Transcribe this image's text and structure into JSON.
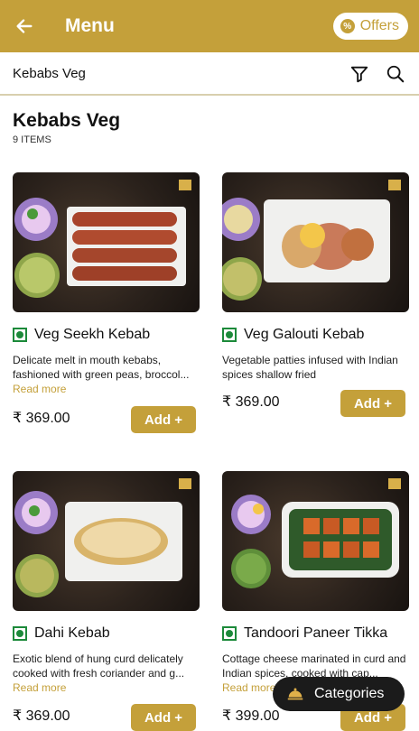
{
  "header": {
    "title": "Menu",
    "offers_label": "Offers"
  },
  "subheader": {
    "title": "Kebabs Veg"
  },
  "section": {
    "heading": "Kebabs Veg",
    "count": "9 ITEMS"
  },
  "items": [
    {
      "name": "Veg Seekh Kebab",
      "desc": "Delicate melt in mouth kebabs, fashioned with green peas, broccol...",
      "more": "Read more",
      "price": "₹ 369.00",
      "add": "Add +"
    },
    {
      "name": "Veg Galouti Kebab",
      "desc": "Vegetable patties infused with Indian spices shallow fried",
      "more": "",
      "price": "₹ 369.00",
      "add": "Add +"
    },
    {
      "name": "Dahi Kebab",
      "desc": "Exotic blend of hung curd delicately cooked with fresh coriander and g...",
      "more": "Read more",
      "price": "₹ 369.00",
      "add": "Add +"
    },
    {
      "name": "Tandoori Paneer Tikka",
      "desc": "Cottage cheese marinated in curd and Indian spices, cooked with cap...",
      "more": "Read more",
      "price": "₹ 399.00",
      "add": "Add +"
    }
  ],
  "categories_button": {
    "label": "Categories"
  },
  "colors": {
    "accent": "#c4a03a",
    "veg_green": "#1c8a3a",
    "dark": "#1b1b1b"
  }
}
